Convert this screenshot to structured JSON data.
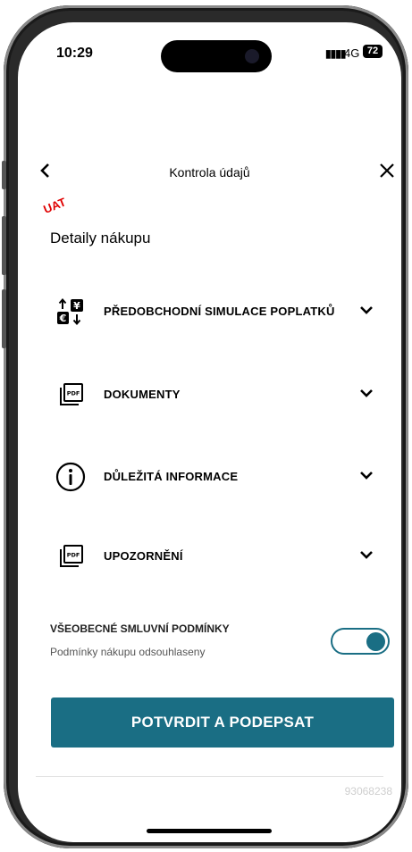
{
  "status_bar": {
    "time": "10:29",
    "network": "4G",
    "battery": "72"
  },
  "header": {
    "title": "Kontrola údajů"
  },
  "env_badge": "UAT",
  "section_title": "Detaily nákupu",
  "accordion": [
    {
      "label": "PŘEDOBCHODNÍ SIMULACE POPLATKŮ",
      "icon": "currency-exchange-icon"
    },
    {
      "label": "DOKUMENTY",
      "icon": "pdf-documents-icon"
    },
    {
      "label": "DŮLEŽITÁ INFORMACE",
      "icon": "info-icon"
    },
    {
      "label": "UPOZORNĚNÍ",
      "icon": "pdf-documents-icon"
    }
  ],
  "terms": {
    "label": "VŠEOBECNÉ SMLUVNÍ PODMÍNKY",
    "sublabel": "Podmínky nákupu odsouhlaseny",
    "enabled": true
  },
  "primary_button": "POTVRDIT A PODEPSAT",
  "footer_code": "93068238",
  "colors": {
    "accent": "#1a6e84",
    "uat_red": "#e00000"
  }
}
